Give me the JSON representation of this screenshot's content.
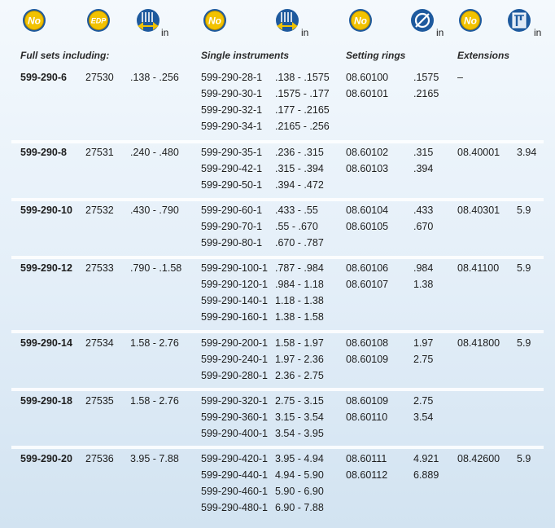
{
  "header": {
    "units": {
      "edp_range": "in",
      "inst_range": "in",
      "ring_dia": "in",
      "ext_length": "in"
    },
    "labels": {
      "full_sets": "Full sets including:",
      "single_instruments": "Single instruments",
      "setting_rings": "Setting rings",
      "extensions": "Extensions"
    },
    "icons": {
      "no1": "No",
      "edp": "EDP",
      "no2": "No",
      "no3": "No",
      "no4": "No"
    },
    "colors": {
      "badge": "#f2c200",
      "badge_dark": "#b38b00",
      "badge_blue": "#1e5a9e"
    }
  },
  "groups": [
    {
      "set": "599-290-6",
      "edp": "27530",
      "range": ".138 - .256",
      "instruments": [
        {
          "no": "599-290-28-1",
          "range": ".138 - .1575"
        },
        {
          "no": "599-290-30-1",
          "range": ".1575 - .177"
        },
        {
          "no": "599-290-32-1",
          "range": ".177 - .2165"
        },
        {
          "no": "599-290-34-1",
          "range": ".2165 - .256"
        }
      ],
      "rings": [
        {
          "no": "08.60100",
          "dia": ".1575"
        },
        {
          "no": "08.60101",
          "dia": ".2165"
        }
      ],
      "extension": {
        "no": "–",
        "len": ""
      }
    },
    {
      "set": "599-290-8",
      "edp": "27531",
      "range": ".240 - .480",
      "instruments": [
        {
          "no": "599-290-35-1",
          "range": ".236 - .315"
        },
        {
          "no": "599-290-42-1",
          "range": ".315 - .394"
        },
        {
          "no": "599-290-50-1",
          "range": ".394 - .472"
        }
      ],
      "rings": [
        {
          "no": "08.60102",
          "dia": ".315"
        },
        {
          "no": "08.60103",
          "dia": ".394"
        }
      ],
      "extension": {
        "no": "08.40001",
        "len": "3.94"
      }
    },
    {
      "set": "599-290-10",
      "edp": "27532",
      "range": ".430 - .790",
      "instruments": [
        {
          "no": "599-290-60-1",
          "range": ".433 - .55"
        },
        {
          "no": "599-290-70-1",
          "range": ".55 - .670"
        },
        {
          "no": "599-290-80-1",
          "range": ".670 - .787"
        }
      ],
      "rings": [
        {
          "no": "08.60104",
          "dia": ".433"
        },
        {
          "no": "08.60105",
          "dia": ".670"
        }
      ],
      "extension": {
        "no": "08.40301",
        "len": "5.9"
      }
    },
    {
      "set": "599-290-12",
      "edp": "27533",
      "range": ".790 - .1.58",
      "instruments": [
        {
          "no": "599-290-100-1",
          "range": ".787 - .984"
        },
        {
          "no": "599-290-120-1",
          "range": ".984 - 1.18"
        },
        {
          "no": "599-290-140-1",
          "range": "1.18 - 1.38"
        },
        {
          "no": "599-290-160-1",
          "range": "1.38 - 1.58"
        }
      ],
      "rings": [
        {
          "no": "08.60106",
          "dia": ".984"
        },
        {
          "no": "08.60107",
          "dia": "1.38"
        }
      ],
      "extension": {
        "no": "08.41100",
        "len": "5.9"
      }
    },
    {
      "set": "599-290-14",
      "edp": "27534",
      "range": "1.58 - 2.76",
      "instruments": [
        {
          "no": "599-290-200-1",
          "range": "1.58 - 1.97"
        },
        {
          "no": "599-290-240-1",
          "range": "1.97 - 2.36"
        },
        {
          "no": "599-290-280-1",
          "range": "2.36 - 2.75"
        }
      ],
      "rings": [
        {
          "no": "08.60108",
          "dia": "1.97"
        },
        {
          "no": "08.60109",
          "dia": "2.75"
        }
      ],
      "extension": {
        "no": "08.41800",
        "len": "5.9"
      }
    },
    {
      "set": "599-290-18",
      "edp": "27535",
      "range": "1.58 - 2.76",
      "instruments": [
        {
          "no": "599-290-320-1",
          "range": "2.75 - 3.15"
        },
        {
          "no": "599-290-360-1",
          "range": "3.15 - 3.54"
        },
        {
          "no": "599-290-400-1",
          "range": "3.54 - 3.95"
        }
      ],
      "rings": [
        {
          "no": "08.60109",
          "dia": "2.75"
        },
        {
          "no": "08.60110",
          "dia": "3.54"
        }
      ],
      "extension": {
        "no": "",
        "len": ""
      }
    },
    {
      "set": "599-290-20",
      "edp": "27536",
      "range": "3.95 - 7.88",
      "instruments": [
        {
          "no": "599-290-420-1",
          "range": "3.95 - 4.94"
        },
        {
          "no": "599-290-440-1",
          "range": "4.94 - 5.90"
        },
        {
          "no": "599-290-460-1",
          "range": "5.90 - 6.90"
        },
        {
          "no": "599-290-480-1",
          "range": "6.90 - 7.88"
        }
      ],
      "rings": [
        {
          "no": "08.60111",
          "dia": "4.921"
        },
        {
          "no": "08.60112",
          "dia": "6.889"
        }
      ],
      "extension": {
        "no": "08.42600",
        "len": "5.9"
      }
    }
  ]
}
